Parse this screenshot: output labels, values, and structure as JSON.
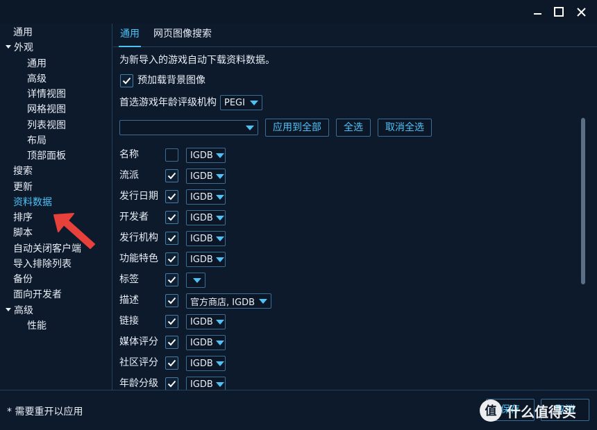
{
  "window": {
    "minimize_icon": "minimize-icon",
    "maximize_icon": "maximize-icon",
    "close_icon": "close-icon"
  },
  "sidebar": {
    "items": [
      {
        "label": "通用",
        "level": 0
      },
      {
        "label": "外观",
        "level": 0,
        "expanded": true
      },
      {
        "label": "通用",
        "level": 1
      },
      {
        "label": "高级",
        "level": 1
      },
      {
        "label": "详情视图",
        "level": 1
      },
      {
        "label": "网格视图",
        "level": 1
      },
      {
        "label": "列表视图",
        "level": 1
      },
      {
        "label": "布局",
        "level": 1
      },
      {
        "label": "顶部面板",
        "level": 1
      },
      {
        "label": "搜索",
        "level": 0
      },
      {
        "label": "更新",
        "level": 0
      },
      {
        "label": "资料数据",
        "level": 0,
        "active": true
      },
      {
        "label": "排序",
        "level": 0
      },
      {
        "label": "脚本",
        "level": 0
      },
      {
        "label": "自动关闭客户端",
        "level": 0
      },
      {
        "label": "导入排除列表",
        "level": 0
      },
      {
        "label": "备份",
        "level": 0
      },
      {
        "label": "面向开发者",
        "level": 0
      },
      {
        "label": "高级",
        "level": 0,
        "expanded": true
      },
      {
        "label": "性能",
        "level": 1
      }
    ]
  },
  "tabs": [
    {
      "label": "通用",
      "active": true
    },
    {
      "label": "网页图像搜索",
      "active": false
    }
  ],
  "main": {
    "description": "为新导入的游戏自动下载资料数据。",
    "preload_bg": {
      "label": "预加载背景图像",
      "checked": true
    },
    "rating_org": {
      "label": "首选游戏年龄评级机构",
      "value": "PEGI"
    },
    "bulk": {
      "select_value": "",
      "apply_all": "应用到全部",
      "select_all": "全选",
      "deselect_all": "取消全选"
    },
    "fields": [
      {
        "label": "名称",
        "checked": false,
        "source": "IGDB"
      },
      {
        "label": "流派",
        "checked": true,
        "source": "IGDB"
      },
      {
        "label": "发行日期",
        "checked": true,
        "source": "IGDB"
      },
      {
        "label": "开发者",
        "checked": true,
        "source": "IGDB"
      },
      {
        "label": "发行机构",
        "checked": true,
        "source": "IGDB"
      },
      {
        "label": "功能特色",
        "checked": true,
        "source": "IGDB"
      },
      {
        "label": "标签",
        "checked": true,
        "source": ""
      },
      {
        "label": "描述",
        "checked": true,
        "source": "官方商店, IGDB"
      },
      {
        "label": "链接",
        "checked": true,
        "source": "IGDB"
      },
      {
        "label": "媒体评分",
        "checked": true,
        "source": "IGDB"
      },
      {
        "label": "社区评分",
        "checked": true,
        "source": "IGDB"
      },
      {
        "label": "年龄分级",
        "checked": true,
        "source": "IGDB"
      }
    ]
  },
  "footer": {
    "note": "* 需要重开以应用",
    "save_label": "保存",
    "cancel_label": "取消"
  },
  "watermark": {
    "text": "什么值得买",
    "logo_char": "值"
  },
  "colors": {
    "accent": "#4ec2f7",
    "background": "#0d1a2b",
    "border": "#3c6d95",
    "arrow": "#e8413c"
  }
}
